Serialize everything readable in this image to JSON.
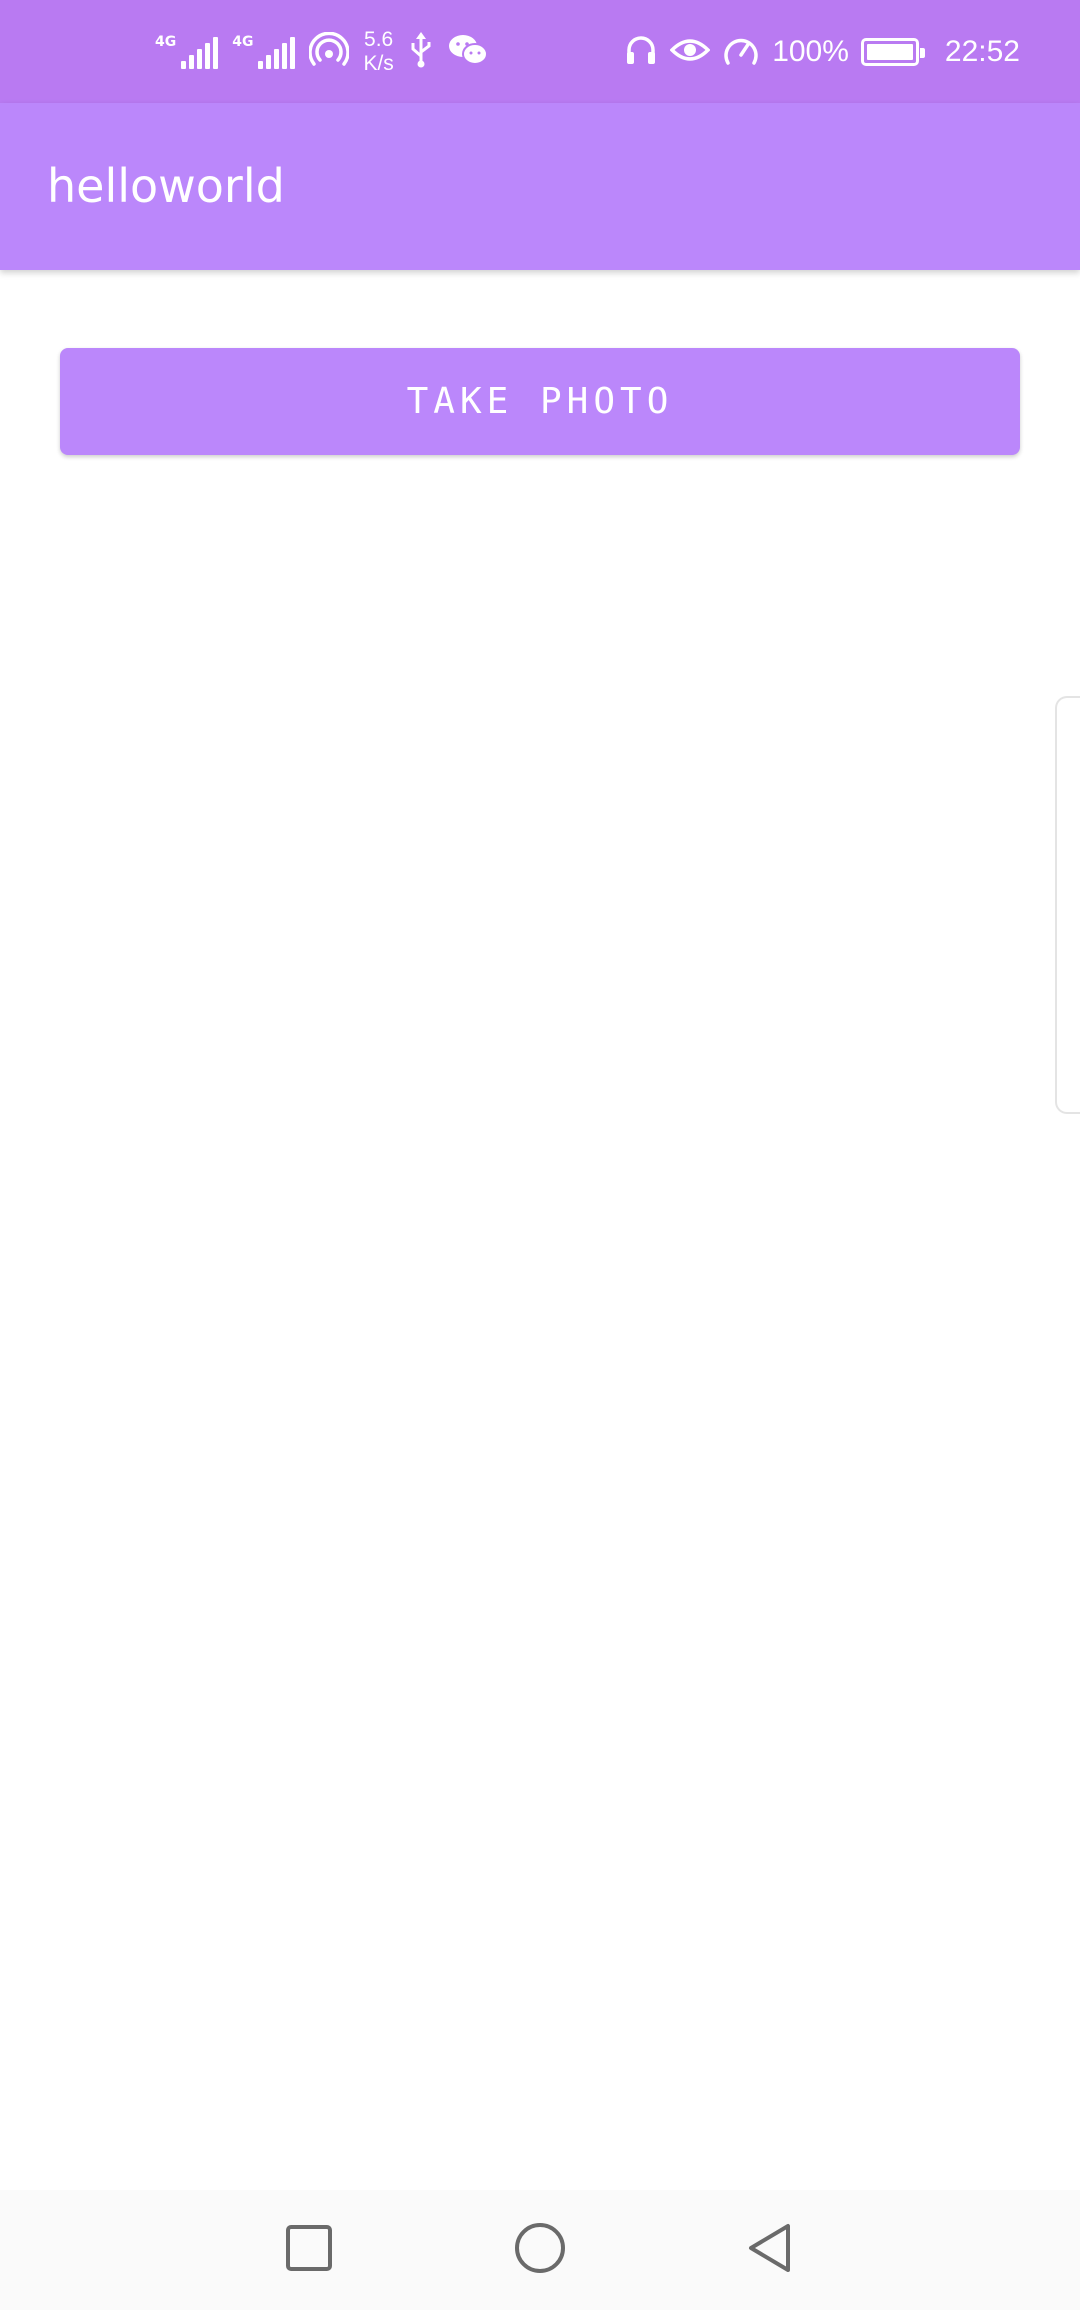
{
  "status_bar": {
    "network_1": "4G",
    "network_2": "4G",
    "speed_value": "5.6",
    "speed_unit": "K/s",
    "battery_percent": "100%",
    "battery_level": 1.0,
    "time": "22:52",
    "icons": [
      "signal-icon",
      "signal-icon",
      "hotspot-icon",
      "usb-icon",
      "wechat-icon",
      "headphones-icon",
      "eye-icon",
      "speedometer-icon",
      "battery-icon"
    ]
  },
  "app_bar": {
    "title": "helloworld"
  },
  "main": {
    "take_photo_label": "TAKE PHOTO"
  },
  "nav_bar": {
    "icons": [
      "recents-square-icon",
      "home-circle-icon",
      "back-triangle-icon"
    ]
  },
  "colors": {
    "status_bar": "#b97af2",
    "accent": "#bb87fb",
    "nav_bar": "#fafafa",
    "nav_icon": "#6a6a6a"
  }
}
